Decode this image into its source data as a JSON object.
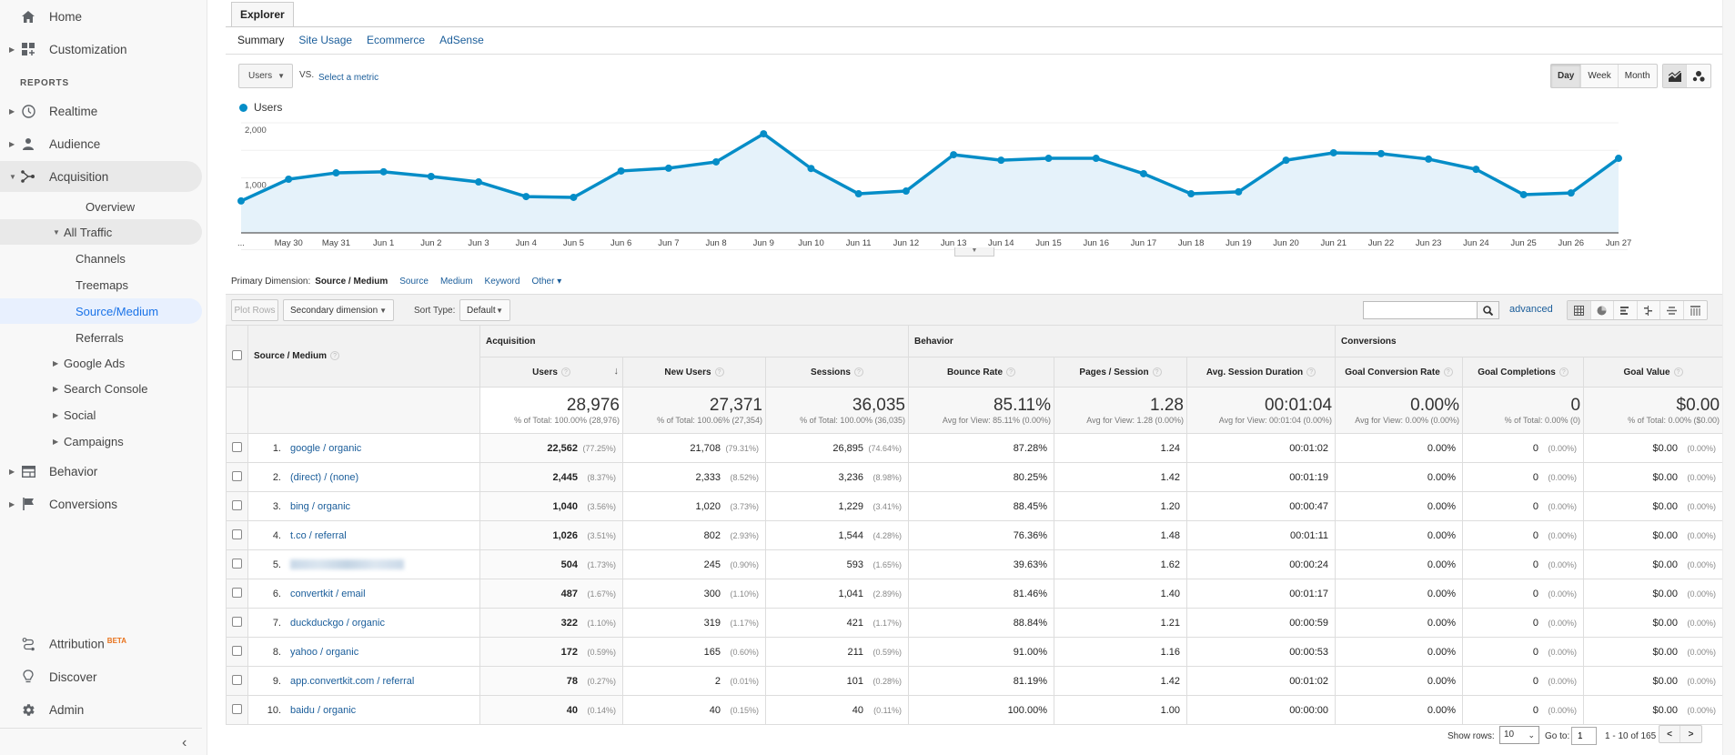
{
  "sidebar": {
    "top_items": [
      {
        "label": "Home",
        "icon": "home-icon"
      },
      {
        "label": "Customization",
        "icon": "dashboard-icon"
      }
    ],
    "section_label": "REPORTS",
    "report_items": [
      {
        "label": "Realtime",
        "icon": "clock-icon"
      },
      {
        "label": "Audience",
        "icon": "person-icon"
      },
      {
        "label": "Acquisition",
        "icon": "acquisition-icon"
      }
    ],
    "acquisition_children": {
      "overview": "Overview",
      "all_traffic": "All Traffic",
      "all_traffic_children": [
        "Channels",
        "Treemaps",
        "Source/Medium",
        "Referrals"
      ],
      "others": [
        "Google Ads",
        "Search Console",
        "Social",
        "Campaigns"
      ]
    },
    "bottom_reports": [
      {
        "label": "Behavior",
        "icon": "behavior-icon"
      },
      {
        "label": "Conversions",
        "icon": "flag-icon"
      }
    ],
    "footer_items": [
      {
        "label": "Attribution",
        "badge": "BETA",
        "icon": "attribution-icon"
      },
      {
        "label": "Discover",
        "icon": "lightbulb-icon"
      },
      {
        "label": "Admin",
        "icon": "gear-icon"
      }
    ],
    "collapse_glyph": "‹"
  },
  "explorer": {
    "tab_label": "Explorer",
    "subtabs": [
      "Summary",
      "Site Usage",
      "Ecommerce",
      "AdSense"
    ],
    "active_subtab": "Summary",
    "metric_select": "Users",
    "vs_label": "VS.",
    "select_metric_link": "Select a metric",
    "periods": [
      "Day",
      "Week",
      "Month"
    ],
    "active_period": "Day",
    "legend_label": "Users",
    "series_color": "#058dc7"
  },
  "chart_data": {
    "type": "area",
    "title": "",
    "xlabel": "",
    "ylabel": "",
    "ylim": [
      0,
      2000
    ],
    "yticks": [
      "1,000",
      "2,000"
    ],
    "ytick_values": [
      1000,
      2000
    ],
    "x": [
      "...",
      "May 30",
      "May 31",
      "Jun 1",
      "Jun 2",
      "Jun 3",
      "Jun 4",
      "Jun 5",
      "Jun 6",
      "Jun 7",
      "Jun 8",
      "Jun 9",
      "Jun 10",
      "Jun 11",
      "Jun 12",
      "Jun 13",
      "Jun 14",
      "Jun 15",
      "Jun 16",
      "Jun 17",
      "Jun 18",
      "Jun 19",
      "Jun 20",
      "Jun 21",
      "Jun 22",
      "Jun 23",
      "Jun 24",
      "Jun 25",
      "Jun 26",
      "Jun 27"
    ],
    "series": [
      {
        "name": "Users",
        "values": [
          580,
          975,
          1090,
          1110,
          1025,
          925,
          660,
          645,
          1125,
          1175,
          1290,
          1800,
          1170,
          710,
          760,
          1420,
          1320,
          1355,
          1355,
          1075,
          710,
          745,
          1320,
          1455,
          1440,
          1340,
          1155,
          695,
          725,
          1355
        ]
      }
    ],
    "grid": true,
    "legend": "top-left"
  },
  "primary_dimension": {
    "label": "Primary Dimension:",
    "active": "Source / Medium",
    "options": [
      "Source",
      "Medium",
      "Keyword",
      "Other ▾"
    ]
  },
  "toolbar": {
    "plot_rows": "Plot Rows",
    "secondary_dimension": "Secondary dimension",
    "sort_type_label": "Sort Type:",
    "sort_type_value": "Default",
    "search_value": "",
    "advanced_link": "advanced"
  },
  "table": {
    "groups": [
      "Acquisition",
      "Behavior",
      "Conversions"
    ],
    "dimension_header": "Source / Medium",
    "columns": [
      "Users",
      "New Users",
      "Sessions",
      "Bounce Rate",
      "Pages / Session",
      "Avg. Session Duration",
      "Goal Conversion Rate",
      "Goal Completions",
      "Goal Value"
    ],
    "totals": [
      {
        "value": "28,976",
        "sub": "% of Total: 100.00% (28,976)"
      },
      {
        "value": "27,371",
        "sub": "% of Total: 100.06% (27,354)"
      },
      {
        "value": "36,035",
        "sub": "% of Total: 100.00% (36,035)"
      },
      {
        "value": "85.11%",
        "sub": "Avg for View: 85.11% (0.00%)"
      },
      {
        "value": "1.28",
        "sub": "Avg for View: 1.28 (0.00%)"
      },
      {
        "value": "00:01:04",
        "sub": "Avg for View: 00:01:04 (0.00%)"
      },
      {
        "value": "0.00%",
        "sub": "Avg for View: 0.00% (0.00%)"
      },
      {
        "value": "0",
        "sub": "% of Total: 0.00% (0)"
      },
      {
        "value": "$0.00",
        "sub": "% of Total: 0.00% ($0.00)"
      }
    ],
    "rows": [
      {
        "idx": "1.",
        "source": "google / organic",
        "users": "22,562",
        "users_pct": "(77.25%)",
        "new_users": "21,708",
        "new_users_pct": "(79.31%)",
        "sessions": "26,895",
        "sessions_pct": "(74.64%)",
        "bounce": "87.28%",
        "pages": "1.24",
        "duration": "00:01:02",
        "conv_rate": "0.00%",
        "completions": "0",
        "completions_pct": "(0.00%)",
        "value": "$0.00",
        "value_pct": "(0.00%)"
      },
      {
        "idx": "2.",
        "source": "(direct) / (none)",
        "users": "2,445",
        "users_pct": "(8.37%)",
        "new_users": "2,333",
        "new_users_pct": "(8.52%)",
        "sessions": "3,236",
        "sessions_pct": "(8.98%)",
        "bounce": "80.25%",
        "pages": "1.42",
        "duration": "00:01:19",
        "conv_rate": "0.00%",
        "completions": "0",
        "completions_pct": "(0.00%)",
        "value": "$0.00",
        "value_pct": "(0.00%)"
      },
      {
        "idx": "3.",
        "source": "bing / organic",
        "users": "1,040",
        "users_pct": "(3.56%)",
        "new_users": "1,020",
        "new_users_pct": "(3.73%)",
        "sessions": "1,229",
        "sessions_pct": "(3.41%)",
        "bounce": "88.45%",
        "pages": "1.20",
        "duration": "00:00:47",
        "conv_rate": "0.00%",
        "completions": "0",
        "completions_pct": "(0.00%)",
        "value": "$0.00",
        "value_pct": "(0.00%)"
      },
      {
        "idx": "4.",
        "source": "t.co / referral",
        "users": "1,026",
        "users_pct": "(3.51%)",
        "new_users": "802",
        "new_users_pct": "(2.93%)",
        "sessions": "1,544",
        "sessions_pct": "(4.28%)",
        "bounce": "76.36%",
        "pages": "1.48",
        "duration": "00:01:11",
        "conv_rate": "0.00%",
        "completions": "0",
        "completions_pct": "(0.00%)",
        "value": "$0.00",
        "value_pct": "(0.00%)"
      },
      {
        "idx": "5.",
        "source": "",
        "redacted": true,
        "users": "504",
        "users_pct": "(1.73%)",
        "new_users": "245",
        "new_users_pct": "(0.90%)",
        "sessions": "593",
        "sessions_pct": "(1.65%)",
        "bounce": "39.63%",
        "pages": "1.62",
        "duration": "00:00:24",
        "conv_rate": "0.00%",
        "completions": "0",
        "completions_pct": "(0.00%)",
        "value": "$0.00",
        "value_pct": "(0.00%)"
      },
      {
        "idx": "6.",
        "source": "convertkit / email",
        "users": "487",
        "users_pct": "(1.67%)",
        "new_users": "300",
        "new_users_pct": "(1.10%)",
        "sessions": "1,041",
        "sessions_pct": "(2.89%)",
        "bounce": "81.46%",
        "pages": "1.40",
        "duration": "00:01:17",
        "conv_rate": "0.00%",
        "completions": "0",
        "completions_pct": "(0.00%)",
        "value": "$0.00",
        "value_pct": "(0.00%)"
      },
      {
        "idx": "7.",
        "source": "duckduckgo / organic",
        "users": "322",
        "users_pct": "(1.10%)",
        "new_users": "319",
        "new_users_pct": "(1.17%)",
        "sessions": "421",
        "sessions_pct": "(1.17%)",
        "bounce": "88.84%",
        "pages": "1.21",
        "duration": "00:00:59",
        "conv_rate": "0.00%",
        "completions": "0",
        "completions_pct": "(0.00%)",
        "value": "$0.00",
        "value_pct": "(0.00%)"
      },
      {
        "idx": "8.",
        "source": "yahoo / organic",
        "users": "172",
        "users_pct": "(0.59%)",
        "new_users": "165",
        "new_users_pct": "(0.60%)",
        "sessions": "211",
        "sessions_pct": "(0.59%)",
        "bounce": "91.00%",
        "pages": "1.16",
        "duration": "00:00:53",
        "conv_rate": "0.00%",
        "completions": "0",
        "completions_pct": "(0.00%)",
        "value": "$0.00",
        "value_pct": "(0.00%)"
      },
      {
        "idx": "9.",
        "source": "app.convertkit.com / referral",
        "users": "78",
        "users_pct": "(0.27%)",
        "new_users": "2",
        "new_users_pct": "(0.01%)",
        "sessions": "101",
        "sessions_pct": "(0.28%)",
        "bounce": "81.19%",
        "pages": "1.42",
        "duration": "00:01:02",
        "conv_rate": "0.00%",
        "completions": "0",
        "completions_pct": "(0.00%)",
        "value": "$0.00",
        "value_pct": "(0.00%)"
      },
      {
        "idx": "10.",
        "source": "baidu / organic",
        "users": "40",
        "users_pct": "(0.14%)",
        "new_users": "40",
        "new_users_pct": "(0.15%)",
        "sessions": "40",
        "sessions_pct": "(0.11%)",
        "bounce": "100.00%",
        "pages": "1.00",
        "duration": "00:00:00",
        "conv_rate": "0.00%",
        "completions": "0",
        "completions_pct": "(0.00%)",
        "value": "$0.00",
        "value_pct": "(0.00%)"
      }
    ]
  },
  "pagination": {
    "show_rows_label": "Show rows:",
    "rows_value": "10",
    "goto_label": "Go to:",
    "goto_value": "1",
    "range_text": "1 - 10 of 165",
    "prev": "<",
    "next": ">"
  }
}
